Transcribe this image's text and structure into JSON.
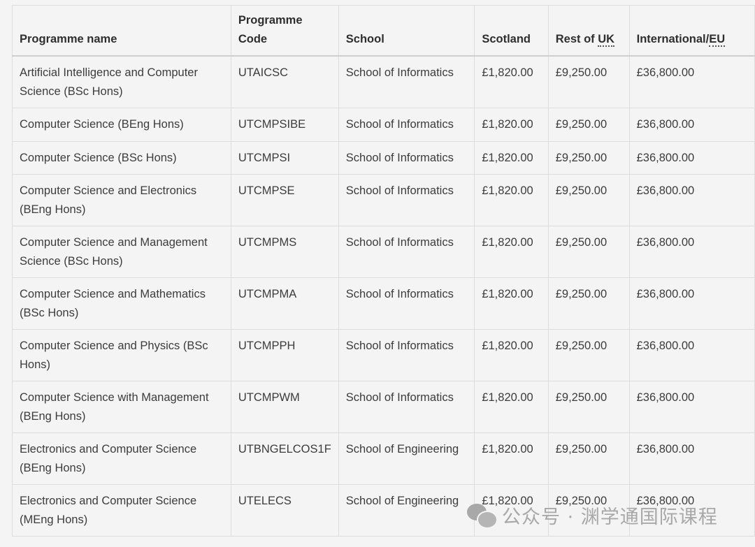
{
  "table": {
    "headers": {
      "name": "Programme name",
      "code": "Programme Code",
      "school": "School",
      "scotland": "Scotland",
      "rest_of_uk_prefix": "Rest of ",
      "rest_of_uk_abbr": "UK",
      "international_prefix": "International/",
      "international_abbr": "EU"
    },
    "rows": [
      {
        "name": "Artificial Intelligence and Computer Science (BSc Hons)",
        "code": "UTAICSC",
        "school": "School of Informatics",
        "scotland": "£1,820.00",
        "rest_of_uk": "£9,250.00",
        "international": "£36,800.00"
      },
      {
        "name": "Computer Science (BEng Hons)",
        "code": "UTCMPSIBE",
        "school": "School of Informatics",
        "scotland": "£1,820.00",
        "rest_of_uk": "£9,250.00",
        "international": "£36,800.00"
      },
      {
        "name": "Computer Science (BSc Hons)",
        "code": "UTCMPSI",
        "school": "School of Informatics",
        "scotland": "£1,820.00",
        "rest_of_uk": "£9,250.00",
        "international": "£36,800.00"
      },
      {
        "name": "Computer Science and Electronics (BEng Hons)",
        "code": "UTCMPSE",
        "school": "School of Informatics",
        "scotland": "£1,820.00",
        "rest_of_uk": "£9,250.00",
        "international": "£36,800.00"
      },
      {
        "name": "Computer Science and Management Science (BSc Hons)",
        "code": "UTCMPMS",
        "school": "School of Informatics",
        "scotland": "£1,820.00",
        "rest_of_uk": "£9,250.00",
        "international": "£36,800.00"
      },
      {
        "name": "Computer Science and Mathematics (BSc Hons)",
        "code": "UTCMPMA",
        "school": "School of Informatics",
        "scotland": "£1,820.00",
        "rest_of_uk": "£9,250.00",
        "international": "£36,800.00"
      },
      {
        "name": "Computer Science and Physics (BSc Hons)",
        "code": "UTCMPPH",
        "school": "School of Informatics",
        "scotland": "£1,820.00",
        "rest_of_uk": "£9,250.00",
        "international": "£36,800.00"
      },
      {
        "name": "Computer Science with Management (BEng Hons)",
        "code": "UTCMPWM",
        "school": "School of Informatics",
        "scotland": "£1,820.00",
        "rest_of_uk": "£9,250.00",
        "international": "£36,800.00"
      },
      {
        "name": "Electronics and Computer Science (BEng Hons)",
        "code": "UTBNGELCOS1F",
        "school": "School of Engineering",
        "scotland": "£1,820.00",
        "rest_of_uk": "£9,250.00",
        "international": "£36,800.00"
      },
      {
        "name": "Electronics and Computer Science (MEng Hons)",
        "code": "UTELECS",
        "school": "School of Engineering",
        "scotland": "£1,820.00",
        "rest_of_uk": "£9,250.00",
        "international": "£36,800.00"
      }
    ]
  },
  "watermark": {
    "icon": "wechat-icon",
    "text": "公众号 · 渊学通国际课程"
  }
}
